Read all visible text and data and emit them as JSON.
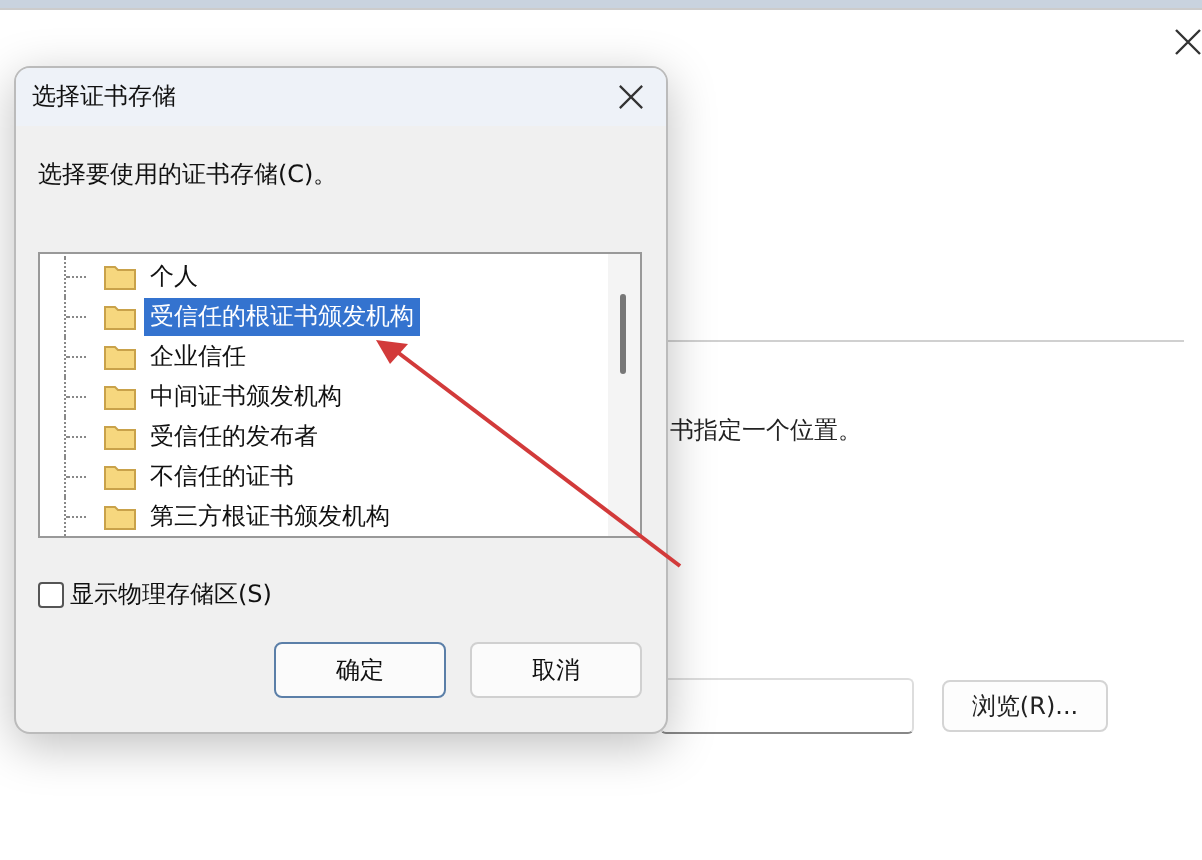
{
  "background_window": {
    "instruction_text": "书指定一个位置。",
    "browse_button": "浏览(R)..."
  },
  "dialog": {
    "title": "选择证书存储",
    "prompt": "选择要使用的证书存储(C)。",
    "stores": [
      {
        "label": "个人",
        "selected": false
      },
      {
        "label": "受信任的根证书颁发机构",
        "selected": true
      },
      {
        "label": "企业信任",
        "selected": false
      },
      {
        "label": "中间证书颁发机构",
        "selected": false
      },
      {
        "label": "受信任的发布者",
        "selected": false
      },
      {
        "label": "不信任的证书",
        "selected": false
      },
      {
        "label": "第三方根证书颁发机构",
        "selected": false
      }
    ],
    "show_physical": {
      "label": "显示物理存储区(S)",
      "checked": false
    },
    "buttons": [
      {
        "label": "确定",
        "kind": "default"
      },
      {
        "label": "取消",
        "kind": "normal"
      }
    ]
  }
}
